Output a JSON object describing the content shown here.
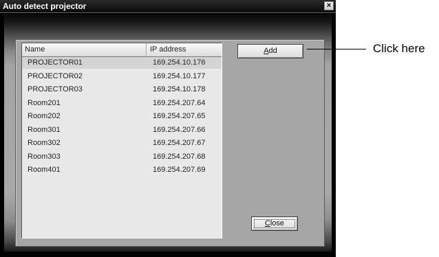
{
  "window": {
    "title": "Auto detect projector",
    "close_glyph": "×"
  },
  "list": {
    "columns": [
      "Name",
      "IP address"
    ],
    "rows": [
      {
        "name": "PROJECTOR01",
        "ip": "169.254.10.176",
        "selected": true
      },
      {
        "name": "PROJECTOR02",
        "ip": "169.254.10.177",
        "selected": false
      },
      {
        "name": "PROJECTOR03",
        "ip": "169.254.10.178",
        "selected": false
      },
      {
        "name": "Room201",
        "ip": "169.254.207.64",
        "selected": false
      },
      {
        "name": "Room202",
        "ip": "169.254.207.65",
        "selected": false
      },
      {
        "name": "Room301",
        "ip": "169.254.207.66",
        "selected": false
      },
      {
        "name": "Room302",
        "ip": "169.254.207.67",
        "selected": false
      },
      {
        "name": "Room303",
        "ip": "169.254.207.68",
        "selected": false
      },
      {
        "name": "Room401",
        "ip": "169.254.207.69",
        "selected": false
      }
    ]
  },
  "buttons": {
    "add_accel": "A",
    "add_rest": "dd",
    "close_accel": "C",
    "close_rest": "lose"
  },
  "callout": {
    "text": "Click here"
  }
}
